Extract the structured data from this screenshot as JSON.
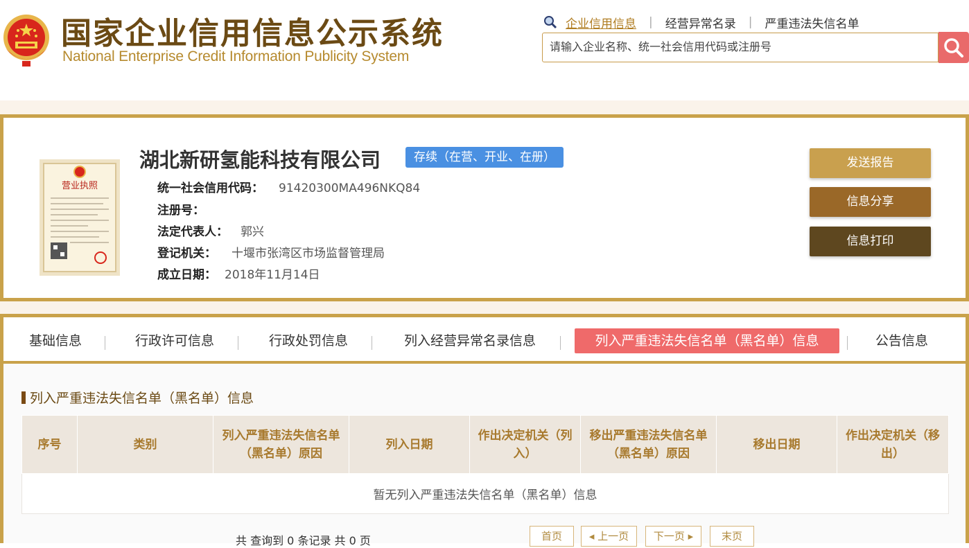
{
  "header": {
    "title_cn": "国家企业信用信息公示系统",
    "title_en": "National Enterprise Credit Information Publicity System",
    "nav": [
      {
        "label": "企业信用信息"
      },
      {
        "label": "经营异常名录"
      },
      {
        "label": "严重违法失信名单"
      }
    ],
    "nav_sep": "|",
    "search_placeholder": "请输入企业名称、统一社会信用代码或注册号"
  },
  "license": {
    "title": "营业执照"
  },
  "company": {
    "name": "湖北新研氢能科技有限公司",
    "status": "存续（在营、开业、在册）",
    "fields": [
      {
        "label": "统一社会信用代码：",
        "value": "91420300MA496NKQ84"
      },
      {
        "label": "注册号：",
        "value": ""
      },
      {
        "label": "法定代表人：",
        "value": "郭兴"
      },
      {
        "label": "登记机关：",
        "value": "十堰市张湾区市场监督管理局"
      },
      {
        "label": "成立日期：",
        "value": "2018年11月14日"
      }
    ]
  },
  "actions": {
    "send": "发送报告",
    "share": "信息分享",
    "print": "信息打印"
  },
  "tabs": [
    {
      "label": "基础信息"
    },
    {
      "label": "行政许可信息"
    },
    {
      "label": "行政处罚信息"
    },
    {
      "label": "列入经营异常名录信息"
    },
    {
      "label": "列入严重违法失信名单（黑名单）信息"
    },
    {
      "label": "公告信息"
    }
  ],
  "tab_sep": "|",
  "section": {
    "title": "列入严重违法失信名单（黑名单）信息",
    "columns": [
      "序号",
      "类别",
      "列入严重违法失信名单（黑名单）原因",
      "列入日期",
      "作出决定机关（列入）",
      "移出严重违法失信名单（黑名单）原因",
      "移出日期",
      "作出决定机关（移出）"
    ],
    "empty_text": "暂无列入严重违法失信名单（黑名单）信息"
  },
  "pagination": {
    "summary": "共 查询到 0 条记录 共 0 页",
    "first": "首页",
    "prev": "上一页",
    "next": "下一页",
    "last": "末页"
  },
  "colors": {
    "brand_brown": "#6b4a14",
    "gold_border": "#c9a24a",
    "active_tab": "#ef6a6a",
    "status_badge": "#4a90e2"
  }
}
